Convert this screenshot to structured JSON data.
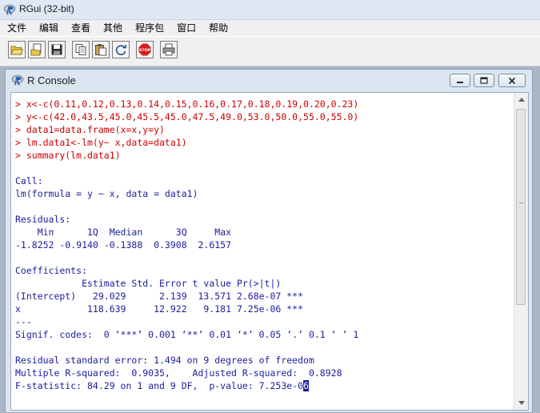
{
  "window": {
    "title": "RGui (32-bit)"
  },
  "menu": [
    "文件",
    "编辑",
    "查看",
    "其他",
    "程序包",
    "窗口",
    "帮助"
  ],
  "toolbar_icons": [
    "open-script-icon",
    "load-workspace-icon",
    "save-icon",
    "copy-icon",
    "paste-icon",
    "refresh-icon",
    "stop-icon",
    "print-icon"
  ],
  "stop_label": "STOP",
  "console": {
    "title": "R Console",
    "lines": [
      {
        "kind": "cmd",
        "text": "> x<-c(0.11,0.12,0.13,0.14,0.15,0.16,0.17,0.18,0.19,0.20,0.23)"
      },
      {
        "kind": "cmd",
        "text": "> y<-c(42.0,43.5,45.0,45.5,45.0,47.5,49.0,53.0,50.0,55.0,55.0)"
      },
      {
        "kind": "cmd",
        "text": "> data1=data.frame(x=x,y=y)"
      },
      {
        "kind": "cmd",
        "text": "> lm.data1<-lm(y~ x,data=data1)"
      },
      {
        "kind": "cmd",
        "text": "> summary(lm.data1)"
      },
      {
        "kind": "out",
        "text": ""
      },
      {
        "kind": "out",
        "text": "Call:"
      },
      {
        "kind": "out",
        "text": "lm(formula = y ~ x, data = data1)"
      },
      {
        "kind": "out",
        "text": ""
      },
      {
        "kind": "out",
        "text": "Residuals:"
      },
      {
        "kind": "out",
        "text": "    Min      1Q  Median      3Q     Max "
      },
      {
        "kind": "out",
        "text": "-1.8252 -0.9140 -0.1388  0.3908  2.6157 "
      },
      {
        "kind": "out",
        "text": ""
      },
      {
        "kind": "out",
        "text": "Coefficients:"
      },
      {
        "kind": "out",
        "text": "            Estimate Std. Error t value Pr(>|t|)    "
      },
      {
        "kind": "out",
        "text": "(Intercept)   29.029      2.139  13.571 2.68e-07 ***"
      },
      {
        "kind": "out",
        "text": "x            118.639     12.922   9.181 7.25e-06 ***"
      },
      {
        "kind": "out",
        "text": "---"
      },
      {
        "kind": "out",
        "text": "Signif. codes:  0 ‘***’ 0.001 ‘**’ 0.01 ‘*’ 0.05 ‘.’ 0.1 ‘ ’ 1"
      },
      {
        "kind": "out",
        "text": ""
      },
      {
        "kind": "out",
        "text": "Residual standard error: 1.494 on 9 degrees of freedom"
      },
      {
        "kind": "out",
        "text": "Multiple R-squared:  0.9035,    Adjusted R-squared:  0.8928 "
      },
      {
        "kind": "out",
        "text": "F-statistic: 84.29 on 1 and 9 DF,  p-value: 7.253e-0",
        "highlight": "6"
      }
    ]
  }
}
